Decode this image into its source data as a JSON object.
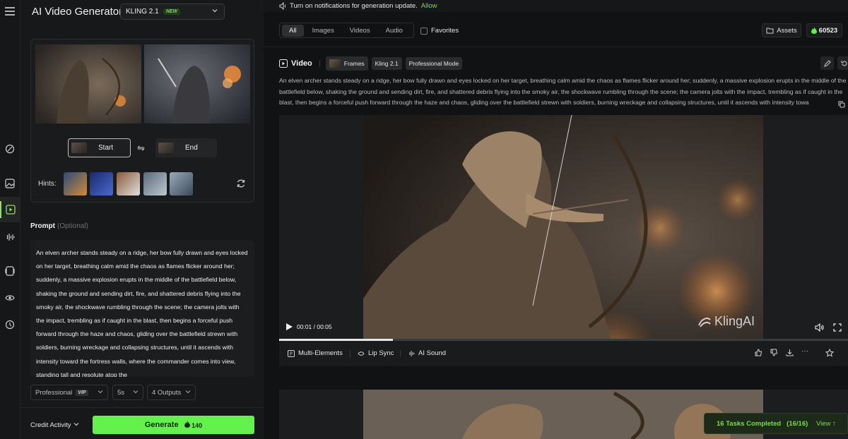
{
  "app": {
    "title": "AI Video Generator"
  },
  "model_select": {
    "value": "KLING 2.1",
    "badge": "NEW"
  },
  "notification": {
    "text": "Turn on notifications for generation update.",
    "allow_label": "Allow"
  },
  "frames": {
    "start_label": "Start",
    "end_label": "End",
    "hints_label": "Hints:"
  },
  "prompt": {
    "label": "Prompt",
    "optional": "(Optional)",
    "text": "An elven archer stands steady on a ridge, her bow fully drawn and eyes locked on her target, breathing calm amid the chaos as flames flicker around her; suddenly, a massive explosion erupts in the middle of the battlefield below, shaking the ground and sending dirt, fire, and shattered debris flying into the smoky air, the shockwave rumbling through the scene; the camera jolts with the impact, trembling as if caught in the blast, then begins a forceful push forward through the haze and chaos, gliding over the battlefield strewn with soldiers, burning wreckage and collapsing structures, until it ascends with intensity toward the fortress walls, where the commander comes into view, standing tall and resolute atop the"
  },
  "options": {
    "mode": "Professional",
    "mode_badge": "VIP",
    "duration": "5s",
    "outputs": "4 Outputs"
  },
  "footer": {
    "credit_activity": "Credit Activity",
    "generate_label": "Generate",
    "generate_cost": "140"
  },
  "filters": {
    "tabs": [
      "All",
      "Images",
      "Videos",
      "Audio"
    ],
    "active_tab": "All",
    "favorites_label": "Favorites",
    "assets_label": "Assets",
    "credits": "60523"
  },
  "result": {
    "type_label": "Video",
    "chips": [
      "Frames",
      "Kling 2.1",
      "Professional Mode"
    ],
    "prompt_text": "An elven archer stands steady on a ridge, her bow fully drawn and eyes locked on her target, breathing calm amid the chaos as flames flicker around her; suddenly, a massive explosion erupts in the middle of the battlefield below, shaking the ground and sending dirt, fire, and shattered debris flying into the smoky air, the shockwave rumbling through the scene; the camera jolts with the impact, trembling as if caught in the blast, then begins a forceful push forward through the haze and chaos, gliding over the battlefield strewn with soldiers, burning wreckage and collapsing structures, until it ascends with intensity towa",
    "time": "00:01 / 00:05",
    "progress": 0.2,
    "watermark": "KlingAI",
    "tools": [
      "Multi-Elements",
      "Lip Sync",
      "AI Sound"
    ]
  },
  "toast": {
    "status": "16 Tasks Completed",
    "count": "(16/16)",
    "view_label": "View"
  },
  "colors": {
    "accent": "#63f24c",
    "accent_text": "#79d94e",
    "background": "#111213",
    "panel": "#17181a"
  }
}
